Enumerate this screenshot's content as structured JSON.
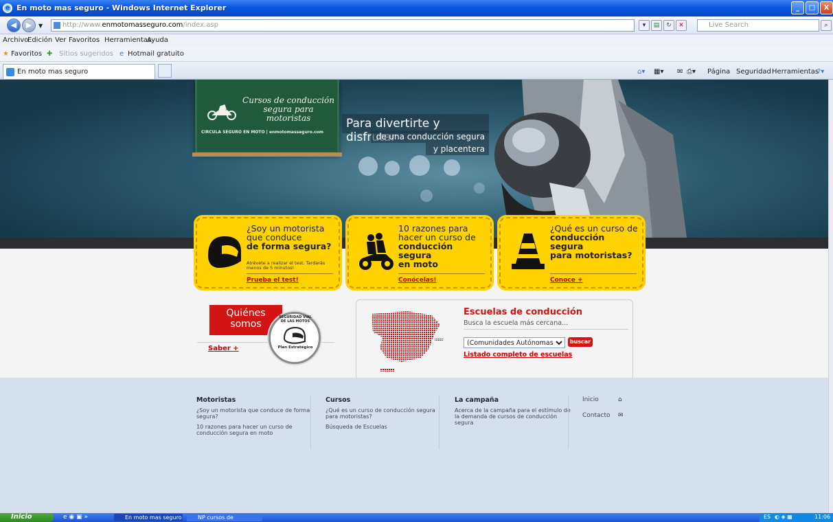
{
  "window": {
    "title": "En moto mas seguro - Windows Internet Explorer",
    "min": "_",
    "max": "□",
    "close": "X"
  },
  "address": {
    "prefix": "http://www.",
    "domain": "enmotomasseguro.com",
    "path": "/index.asp",
    "search_placeholder": "Live Search"
  },
  "menu": {
    "items": [
      "Archivo",
      "Edición",
      "Ver",
      "Favoritos",
      "Herramientas",
      "Ayuda"
    ]
  },
  "favbar": {
    "favorites": "Favoritos",
    "suggested": "Sitios sugeridos",
    "hotmail": "Hotmail gratuito"
  },
  "tab": {
    "title": "En moto mas seguro"
  },
  "cmdbar": {
    "page": "Página",
    "security": "Seguridad",
    "tools": "Herramientas"
  },
  "hero": {
    "chalk_title": "Cursos de conducción segura para motoristas",
    "chalk_bottom": "CIRCULA SEGURO EN MOTO | enmotomasseguro.com",
    "slogan_1": "Para divertirte y disfrutar",
    "slogan_2": "de una conducción segura",
    "slogan_3": "y placentera"
  },
  "cards": [
    {
      "line1": "¿Soy un motorista",
      "line2": "que conduce",
      "line3": "de forma segura?",
      "sub": "Atrévete a realizar el test. Tardarás menos de 5 minutos!",
      "link": "Prueba el test!"
    },
    {
      "line1": "10 razones para",
      "line2": "hacer un curso de",
      "line3": "conducción segura",
      "line4": "en moto",
      "link": "Conócelas!"
    },
    {
      "line1": "¿Qué es un curso de",
      "line2": "conducción segura",
      "line3": "para motoristas?",
      "link": "Conoce +"
    }
  ],
  "quienes": {
    "title_1": "Quiénes",
    "title_2": "somos",
    "link": "Saber +",
    "badge_1": "SEGURIDAD VIAL DE LAS MOTOS",
    "badge_2": "Plan Estratégico"
  },
  "escuelas": {
    "title": "Escuelas de conducción",
    "subtitle": "Busca la escuela más cercana...",
    "select": "(Comunidades Autónomas)",
    "button": "buscar",
    "link": "Listado completo de escuelas"
  },
  "footer": {
    "col1": {
      "title": "Motoristas",
      "links": [
        "¿Soy un motorista que conduce de forma segura?",
        "10 razones para hacer un curso de conducción segura en moto"
      ]
    },
    "col2": {
      "title": "Cursos",
      "links": [
        "¿Qué es un curso de conducción segura para motoristas?",
        "Búsqueda de Escuelas"
      ]
    },
    "col3": {
      "title": "La campaña",
      "links": [
        "Acerca de la campaña para el estímulo de la demanda de cursos de conducción segura"
      ]
    },
    "col4": {
      "links": [
        "Inicio",
        "Contacto"
      ]
    }
  },
  "taskbar": {
    "start": "Inicio",
    "task1": "En moto mas seguro -...",
    "task2": "NP cursos de conducc...",
    "lang": "ES",
    "time": "11:06"
  }
}
